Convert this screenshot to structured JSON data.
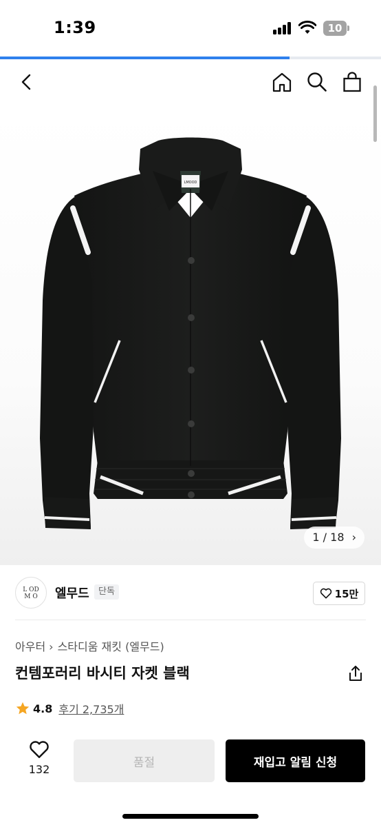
{
  "status_bar": {
    "time": "1:39",
    "battery": "10"
  },
  "page_progress": 0.76,
  "nav": {
    "icons": [
      "back-icon",
      "home-icon",
      "search-icon",
      "shopping-bag-icon"
    ]
  },
  "image": {
    "counter": "1 / 18",
    "jacket_label": "LMOOD"
  },
  "brand": {
    "logo_text": "LMOOD",
    "name": "엘무드",
    "badge": "단독",
    "likes": "15만"
  },
  "breadcrumb": {
    "category": "아우터",
    "subcategory": "스타디움 재킷 (엘무드)"
  },
  "product": {
    "title": "컨템포러리 바시티 자켓 블랙",
    "rating": "4.8",
    "reviews": "후기 2,735개"
  },
  "bottom_bar": {
    "wish_count": "132",
    "soldout_label": "품절",
    "restock_label": "재입고 알림 신청"
  },
  "colors": {
    "accent_blue": "#2f80ed",
    "star": "#f5a623",
    "primary_button": "#000000"
  }
}
